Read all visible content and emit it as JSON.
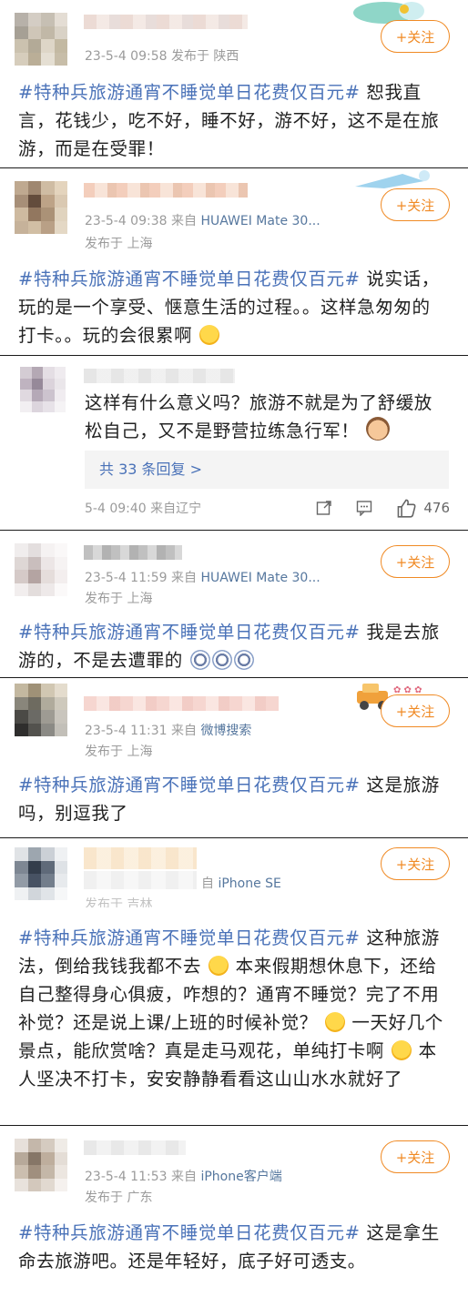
{
  "colors": {
    "accent": "#f08a24",
    "topic": "#4a72b8",
    "meta": "#9b9b9b"
  },
  "follow_label": "+关注",
  "posts": [
    {
      "meta_line1": "23-5-4 09:58  发布于 陕西",
      "topic": "#特种兵旅游通宵不睡觉单日花费仅百元#",
      "text": "恕我直言，花钱少，吃不好，睡不好，游不好，这不是在旅游，而是在受罪！"
    },
    {
      "meta_line1": "23-5-4 09:38  来自",
      "source": "HUAWEI Mate 30...",
      "meta_line2": "发布于 上海",
      "topic": "#特种兵旅游通宵不睡觉单日花费仅百元#",
      "text": "说实话，玩的是一个享受、惬意生活的过程。。这样急匆匆的打卡。。玩的会很累啊"
    },
    {
      "text": "这样有什么意义吗？旅游不就是为了舒缓放松自己，又不是野营拉练急行军！",
      "replies": "共 33 条回复 >",
      "meta_line1": "5-4 09:40  来自辽宁",
      "likes": "476"
    },
    {
      "meta_line1": "23-5-4 11:59  来自",
      "source": "HUAWEI Mate 30...",
      "meta_line2": "发布于 上海",
      "topic": "#特种兵旅游通宵不睡觉单日花费仅百元#",
      "text": "我是去旅游的，不是去遭罪的"
    },
    {
      "meta_line1": "23-5-4 11:31  来自",
      "source": "微博搜索",
      "meta_line2": "发布于 上海",
      "topic": "#特种兵旅游通宵不睡觉单日花费仅百元#",
      "text": "这是旅游吗，别逗我了"
    },
    {
      "meta_line1": "自",
      "source": "iPhone SE",
      "meta_line2": "发布于 吉林",
      "topic": "#特种兵旅游通宵不睡觉单日花费仅百元#",
      "text_a": "这种旅游法，倒给我钱我都不去",
      "text_b": "本来假期想休息下，还给自己整得身心俱疲，咋想的？通宵不睡觉？完了不用补觉？还是说上课/上班的时候补觉？",
      "text_c": "一天好几个景点，能欣赏啥？真是走马观花，单纯打卡啊",
      "text_d": "本人坚决不打卡，安安静静看看这山山水水就好了"
    },
    {
      "meta_line1": "23-5-4 11:53  来自",
      "source": "iPhone客户端",
      "meta_line2": "发布于 广东",
      "topic": "#特种兵旅游通宵不睡觉单日花费仅百元#",
      "text": "这是拿生命去旅游吧。还是年轻好，底子好可透支。"
    }
  ]
}
